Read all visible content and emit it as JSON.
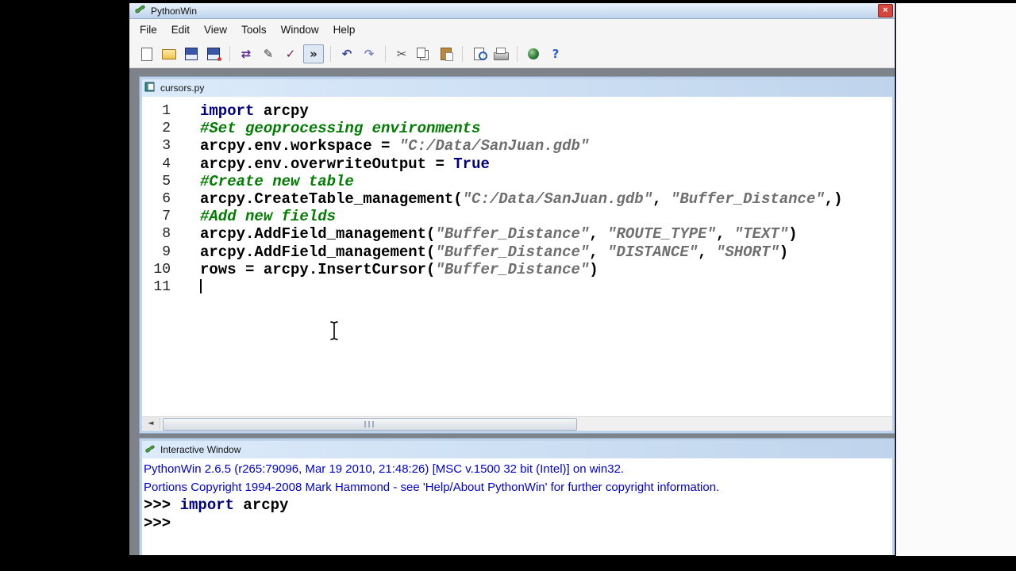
{
  "app": {
    "title": "PythonWin",
    "close_glyph": "×"
  },
  "menu": {
    "items": [
      "File",
      "Edit",
      "View",
      "Tools",
      "Window",
      "Help"
    ]
  },
  "toolbar": {
    "icons": [
      {
        "name": "new-file",
        "glyph": ""
      },
      {
        "name": "open-file",
        "glyph": ""
      },
      {
        "name": "save",
        "glyph": ""
      },
      {
        "name": "save-all",
        "glyph": ""
      },
      {
        "name": "separator"
      },
      {
        "name": "import-reload",
        "glyph": "⇄",
        "color": "#5b2d8e"
      },
      {
        "name": "run-script",
        "glyph": "✎",
        "color": "#3a3a3a"
      },
      {
        "name": "check-syntax",
        "glyph": "✓",
        "color": "#7d2349"
      },
      {
        "name": "interactive-toggle",
        "glyph": "»",
        "color": "#222222",
        "pressed": true
      },
      {
        "name": "separator"
      },
      {
        "name": "undo",
        "glyph": "↶",
        "color": "#32409b"
      },
      {
        "name": "redo",
        "glyph": "↷",
        "color": "#7c86c2"
      },
      {
        "name": "separator"
      },
      {
        "name": "cut",
        "glyph": "✂",
        "color": "#444444"
      },
      {
        "name": "copy",
        "glyph": ""
      },
      {
        "name": "paste",
        "glyph": ""
      },
      {
        "name": "separator"
      },
      {
        "name": "print-preview",
        "glyph": ""
      },
      {
        "name": "print",
        "glyph": ""
      },
      {
        "name": "separator"
      },
      {
        "name": "web-help",
        "glyph": ""
      },
      {
        "name": "help",
        "glyph": "?",
        "color": "#2f5bd7"
      }
    ]
  },
  "editor": {
    "title": "cursors.py",
    "caret_line": 11,
    "scrollbar": {
      "left_arrow": "◄"
    },
    "lines": [
      {
        "num": 1,
        "tokens": [
          {
            "c": "kw",
            "t": "import"
          },
          {
            "c": "code",
            "t": " arcpy"
          }
        ]
      },
      {
        "num": 2,
        "tokens": [
          {
            "c": "com",
            "t": "#Set geoprocessing environments"
          }
        ]
      },
      {
        "num": 3,
        "tokens": [
          {
            "c": "code",
            "t": "arcpy.env.workspace = "
          },
          {
            "c": "str",
            "t": "\"C:/Data/SanJuan.gdb\""
          }
        ]
      },
      {
        "num": 4,
        "tokens": [
          {
            "c": "code",
            "t": "arcpy.env.overwriteOutput = "
          },
          {
            "c": "kw",
            "t": "True"
          }
        ]
      },
      {
        "num": 5,
        "tokens": [
          {
            "c": "com",
            "t": "#Create new table"
          }
        ]
      },
      {
        "num": 6,
        "tokens": [
          {
            "c": "code",
            "t": "arcpy.CreateTable_management("
          },
          {
            "c": "str",
            "t": "\"C:/Data/SanJuan.gdb\""
          },
          {
            "c": "code",
            "t": ", "
          },
          {
            "c": "str",
            "t": "\"Buffer_Distance\""
          },
          {
            "c": "code",
            "t": ",)"
          }
        ]
      },
      {
        "num": 7,
        "tokens": [
          {
            "c": "com",
            "t": "#Add new fields"
          }
        ]
      },
      {
        "num": 8,
        "tokens": [
          {
            "c": "code",
            "t": "arcpy.AddField_management("
          },
          {
            "c": "str",
            "t": "\"Buffer_Distance\""
          },
          {
            "c": "code",
            "t": ", "
          },
          {
            "c": "str",
            "t": "\"ROUTE_TYPE\""
          },
          {
            "c": "code",
            "t": ", "
          },
          {
            "c": "str",
            "t": "\"TEXT\""
          },
          {
            "c": "code",
            "t": ")"
          }
        ]
      },
      {
        "num": 9,
        "tokens": [
          {
            "c": "code",
            "t": "arcpy.AddField_management("
          },
          {
            "c": "str",
            "t": "\"Buffer_Distance\""
          },
          {
            "c": "code",
            "t": ", "
          },
          {
            "c": "str",
            "t": "\"DISTANCE\""
          },
          {
            "c": "code",
            "t": ", "
          },
          {
            "c": "str",
            "t": "\"SHORT\""
          },
          {
            "c": "code",
            "t": ")"
          }
        ]
      },
      {
        "num": 10,
        "tokens": [
          {
            "c": "code",
            "t": "rows = arcpy.InsertCursor("
          },
          {
            "c": "str",
            "t": "\"Buffer_Distance\""
          },
          {
            "c": "code",
            "t": ")"
          }
        ]
      },
      {
        "num": 11,
        "tokens": []
      }
    ]
  },
  "interactive": {
    "title": "Interactive Window",
    "lines": [
      {
        "tokens": [
          {
            "c": "banner",
            "t": "PythonWin 2.6.5 (r265:79096, Mar 19 2010, 21:48:26) [MSC v.1500 32 bit (Intel)] on win32."
          }
        ]
      },
      {
        "tokens": [
          {
            "c": "banner",
            "t": "Portions Copyright 1994-2008 Mark Hammond - see 'Help/About PythonWin' for further copyright information."
          }
        ]
      },
      {
        "tokens": [
          {
            "c": "prompt",
            "t": ">>> "
          },
          {
            "c": "kw",
            "t": "import"
          },
          {
            "c": "code",
            "t": " arcpy"
          }
        ]
      },
      {
        "tokens": [
          {
            "c": "prompt",
            "t": ">>>"
          }
        ]
      }
    ]
  },
  "syntax_colors": {
    "keyword": "#00007f",
    "comment": "#007d00",
    "string": "#6f6f6f",
    "code": "#000000",
    "banner": "#0000e0",
    "prompt": "#000000"
  },
  "colors": {
    "close_button": "#d4473c",
    "mdi_background": "#7e8289",
    "titlebar_top": "#eaf2fc",
    "titlebar_bottom": "#bdd3ec"
  }
}
